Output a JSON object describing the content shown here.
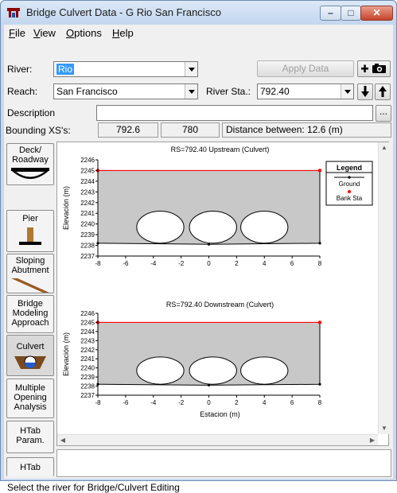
{
  "window": {
    "title": "Bridge Culvert Data - G Rio San Francisco",
    "min_glyph": "–",
    "max_glyph": "□",
    "close_glyph": "✕"
  },
  "menu": [
    {
      "label": "File",
      "key": "F",
      "rest": "ile"
    },
    {
      "label": "View",
      "key": "V",
      "rest": "iew"
    },
    {
      "label": "Options",
      "key": "O",
      "rest": "ptions"
    },
    {
      "label": "Help",
      "key": "H",
      "rest": "elp"
    }
  ],
  "form": {
    "river_label": "River:",
    "river_value": "Rio",
    "apply_button": "Apply Data",
    "reach_label": "Reach:",
    "reach_value": "San Francisco",
    "river_sta_label": "River Sta.:",
    "river_sta_value": "792.40",
    "description_label": "Description",
    "description_value": "",
    "ellipsis_button": "...",
    "bounding_label": "Bounding XS's:",
    "bounding_xs": [
      "792.6",
      "780"
    ],
    "distance_text": "Distance between: 12.6 (m)"
  },
  "sidebar": [
    {
      "label": "Deck/\nRoadway",
      "icon": "deck-icon"
    },
    {
      "label": "Pier",
      "icon": "pier-icon"
    },
    {
      "label": "Sloping\nAbutment",
      "icon": "abutment-icon"
    },
    {
      "label": "Bridge\nModeling\nApproach",
      "icon": ""
    },
    {
      "label": "Culvert",
      "icon": "culvert-icon"
    },
    {
      "label": "Multiple\nOpening\nAnalysis",
      "icon": ""
    },
    {
      "label": "HTab\nParam.",
      "icon": ""
    },
    {
      "label": "HTab",
      "icon": ""
    }
  ],
  "legend": {
    "title": "Legend",
    "items": [
      "Ground",
      "Bank Sta"
    ]
  },
  "colors": {
    "ground_fill": "#c8c8c8",
    "water_line": "#ff0000",
    "bank_station": "#ff0000",
    "selection": "#3399ff"
  },
  "chart_data": [
    {
      "type": "line",
      "title": "RS=792.40  Upstream  (Culvert)",
      "xlabel": "",
      "ylabel": "Elevación (m)",
      "xlim": [
        -8,
        8
      ],
      "ylim": [
        2237,
        2246
      ],
      "x_ticks": [
        -8,
        -6,
        -4,
        -2,
        0,
        2,
        4,
        6,
        8
      ],
      "y_ticks": [
        2237,
        2238,
        2239,
        2240,
        2241,
        2242,
        2243,
        2244,
        2245,
        2246
      ],
      "series": [
        {
          "name": "Ground",
          "x": [
            -8,
            -8,
            0,
            8,
            8
          ],
          "y": [
            2245,
            2238.2,
            2238.1,
            2238.2,
            2245
          ]
        },
        {
          "name": "Bank Sta",
          "x": [
            -8,
            8
          ],
          "y": [
            2245,
            2245
          ]
        }
      ],
      "culverts": [
        {
          "center_x": -3.5,
          "center_y": 2239.7,
          "span": 3.4,
          "rise": 3.0
        },
        {
          "center_x": 0.3,
          "center_y": 2239.7,
          "span": 3.4,
          "rise": 3.0
        },
        {
          "center_x": 4.0,
          "center_y": 2239.7,
          "span": 3.4,
          "rise": 3.0
        }
      ]
    },
    {
      "type": "line",
      "title": "RS=792.40  Downstream  (Culvert)",
      "xlabel": "Estacion (m)",
      "ylabel": "Elevación (m)",
      "xlim": [
        -8,
        8
      ],
      "ylim": [
        2237,
        2246
      ],
      "x_ticks": [
        -8,
        -6,
        -4,
        -2,
        0,
        2,
        4,
        6,
        8
      ],
      "y_ticks": [
        2237,
        2238,
        2239,
        2240,
        2241,
        2242,
        2243,
        2244,
        2245,
        2246
      ],
      "series": [
        {
          "name": "Ground",
          "x": [
            -8,
            -8,
            0,
            8,
            8
          ],
          "y": [
            2245,
            2238.2,
            2238.1,
            2238.2,
            2245
          ]
        },
        {
          "name": "Bank Sta",
          "x": [
            -8,
            8
          ],
          "y": [
            2245,
            2245
          ]
        }
      ],
      "culverts": [
        {
          "center_x": -3.5,
          "center_y": 2239.7,
          "span": 3.4,
          "rise": 3.0
        },
        {
          "center_x": 0.3,
          "center_y": 2239.7,
          "span": 3.4,
          "rise": 3.0
        },
        {
          "center_x": 4.0,
          "center_y": 2239.7,
          "span": 3.4,
          "rise": 3.0
        }
      ]
    }
  ],
  "status": {
    "text": "Select the river for Bridge/Culvert Editing"
  }
}
